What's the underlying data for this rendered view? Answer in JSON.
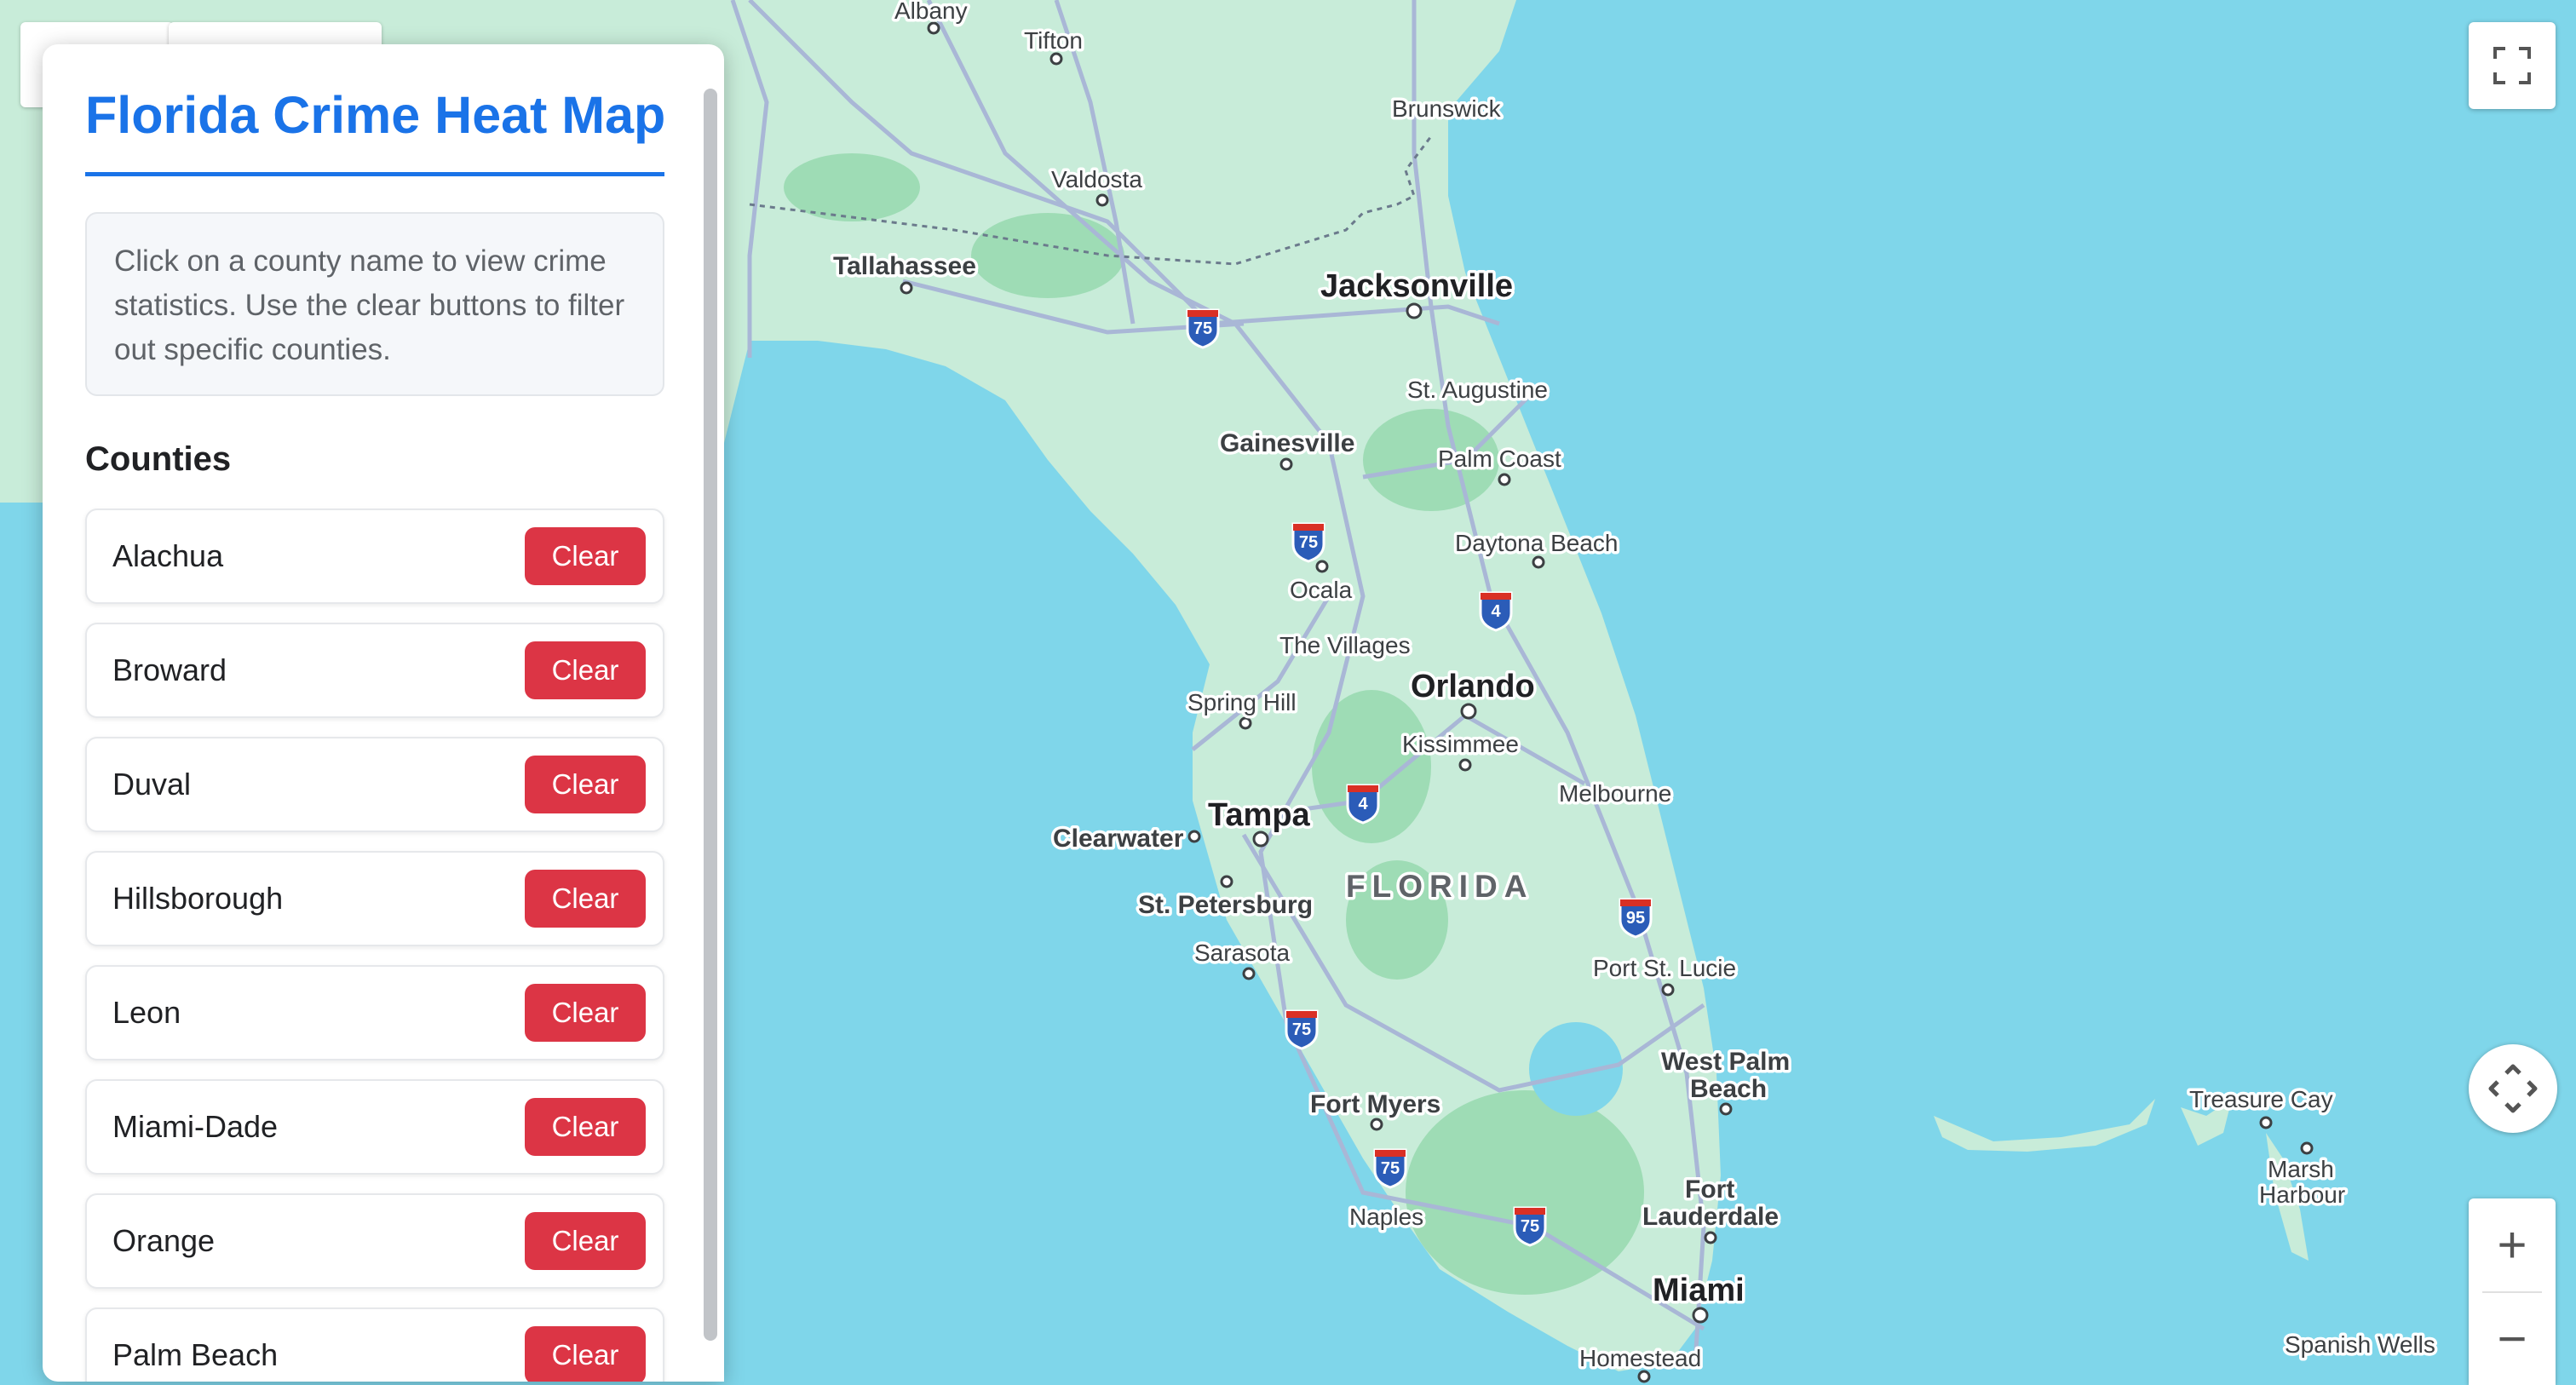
{
  "panel": {
    "title": "Florida Crime Heat Map",
    "info": "Click on a county name to view crime statistics. Use the clear buttons to filter out specific counties.",
    "section_title": "Counties",
    "clear_label": "Clear",
    "counties": [
      "Alachua",
      "Broward",
      "Duval",
      "Hillsborough",
      "Leon",
      "Miami-Dade",
      "Orange",
      "Palm Beach"
    ]
  },
  "map": {
    "state_label": "FLORIDA",
    "cities": {
      "albany": "Albany",
      "tifton": "Tifton",
      "brunswick": "Brunswick",
      "valdosta": "Valdosta",
      "tallahassee": "Tallahassee",
      "jacksonville": "Jacksonville",
      "st_augustine": "St. Augustine",
      "gainesville": "Gainesville",
      "palm_coast": "Palm Coast",
      "daytona_beach": "Daytona Beach",
      "ocala": "Ocala",
      "the_villages": "The Villages",
      "orlando": "Orlando",
      "spring_hill": "Spring Hill",
      "kissimmee": "Kissimmee",
      "melbourne": "Melbourne",
      "tampa": "Tampa",
      "clearwater": "Clearwater",
      "st_petersburg": "St. Petersburg",
      "sarasota": "Sarasota",
      "port_st_lucie": "Port St. Lucie",
      "west_palm_beach_1": "West Palm",
      "west_palm_beach_2": "Beach",
      "fort_myers": "Fort Myers",
      "naples": "Naples",
      "fort_lauderdale_1": "Fort",
      "fort_lauderdale_2": "Lauderdale",
      "miami": "Miami",
      "homestead": "Homestead",
      "treasure_cay": "Treasure Cay",
      "marsh_harbour_1": "Marsh",
      "marsh_harbour_2": "Harbour",
      "spanish_wells": "Spanish Wells"
    },
    "interstates": [
      "75",
      "75",
      "75",
      "75",
      "75",
      "4",
      "4",
      "95"
    ],
    "colors": {
      "water": "#7fd6ea",
      "land": "#c8ecd9",
      "park": "#9edcb5",
      "road": "#a9b7d6",
      "interstate_shield": "#2b5cb8"
    }
  },
  "controls": {
    "fullscreen_icon": "fullscreen-icon",
    "pan_icon": "pan-arrows-icon",
    "zoom_in": "+",
    "zoom_out": "−"
  }
}
